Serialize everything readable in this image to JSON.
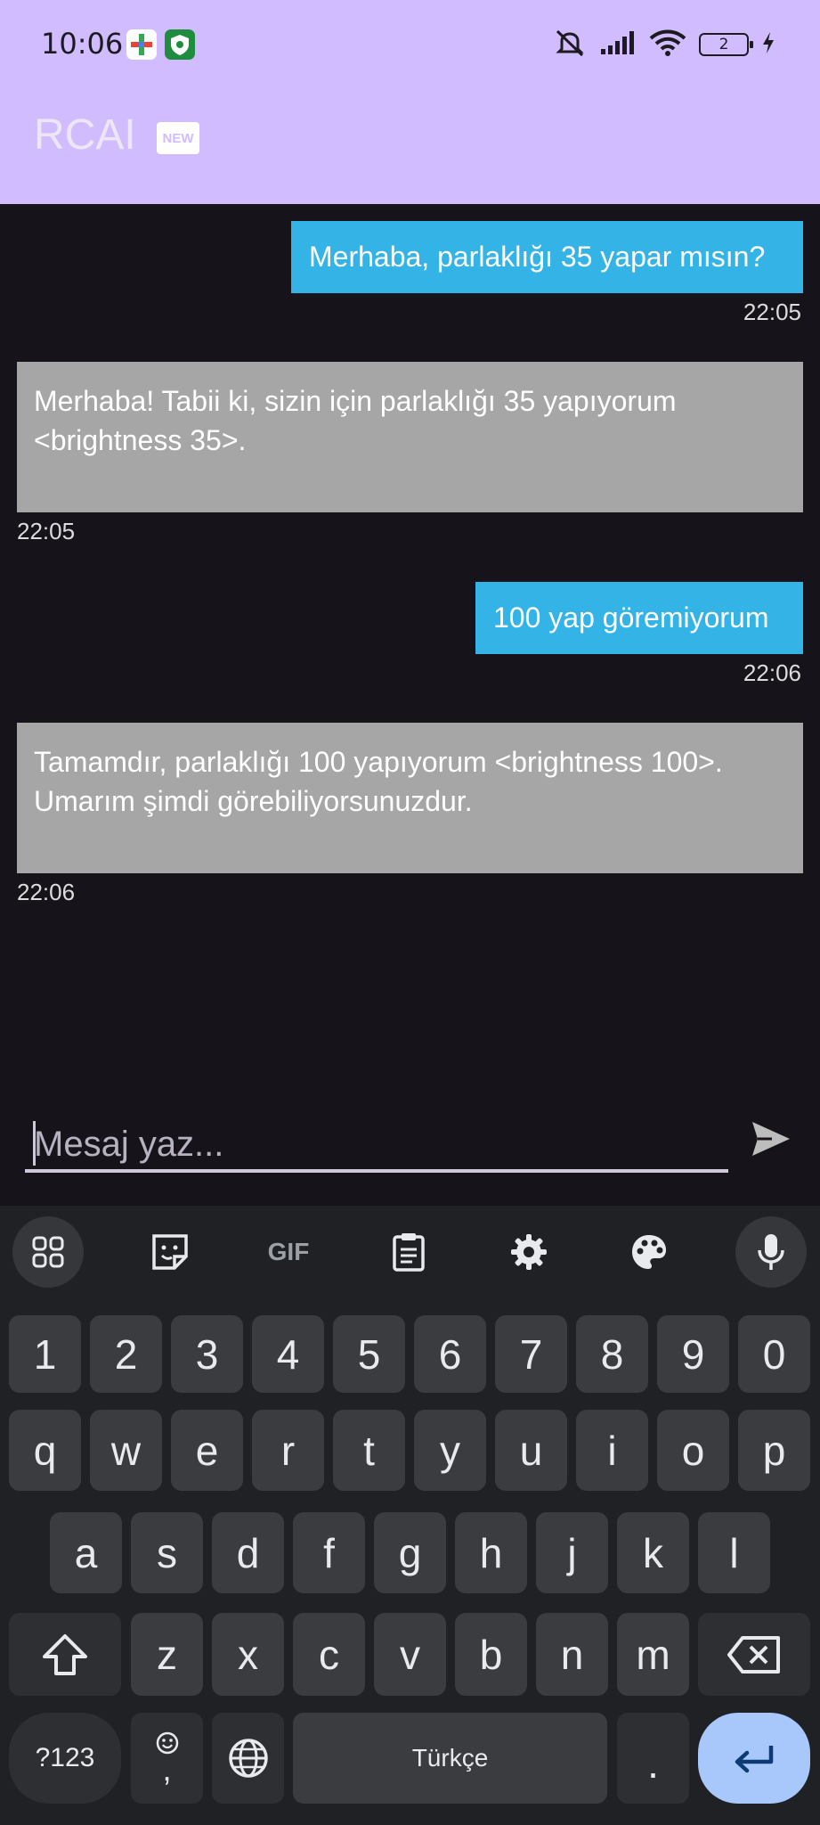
{
  "status_bar": {
    "time": "10:06",
    "battery": "2"
  },
  "app_bar": {
    "title": "RCAI",
    "badge": "NEW"
  },
  "messages": [
    {
      "role": "user",
      "text": "Merhaba, parlaklığı 35 yapar mısın?",
      "time": "22:05"
    },
    {
      "role": "bot",
      "text": "Merhaba! Tabii ki, sizin için parlaklığı 35 yapıyorum <brightness 35>.",
      "time": "22:05"
    },
    {
      "role": "user",
      "text": "100 yap göremiyorum",
      "time": "22:06"
    },
    {
      "role": "bot",
      "text": "Tamamdır, parlaklığı 100 yapıyorum <brightness 100>. Umarım şimdi görebiliyorsunuzdur.",
      "time": "22:06"
    }
  ],
  "composer": {
    "placeholder": "Mesaj yaz...",
    "value": ""
  },
  "keyboard": {
    "toolbar": [
      "apps-grid-icon",
      "sticker-icon",
      "GIF",
      "clipboard-icon",
      "settings-gear-icon",
      "palette-icon",
      "microphone-icon"
    ],
    "gif_label": "GIF",
    "row_numbers": [
      "1",
      "2",
      "3",
      "4",
      "5",
      "6",
      "7",
      "8",
      "9",
      "0"
    ],
    "row_1": [
      "q",
      "w",
      "e",
      "r",
      "t",
      "y",
      "u",
      "i",
      "o",
      "p"
    ],
    "row_2": [
      "a",
      "s",
      "d",
      "f",
      "g",
      "h",
      "j",
      "k",
      "l"
    ],
    "row_3": [
      "z",
      "x",
      "c",
      "v",
      "b",
      "n",
      "m"
    ],
    "symbols_label": "?123",
    "emoji_comma_label": ",",
    "space_label": "Türkçe",
    "period_label": "."
  },
  "colors": {
    "app_bar": "#d0bcff",
    "user_bubble": "#34b3e6",
    "bot_bubble": "#a6a6a6",
    "background": "#16141a",
    "enter_key": "#a8c7fa"
  }
}
